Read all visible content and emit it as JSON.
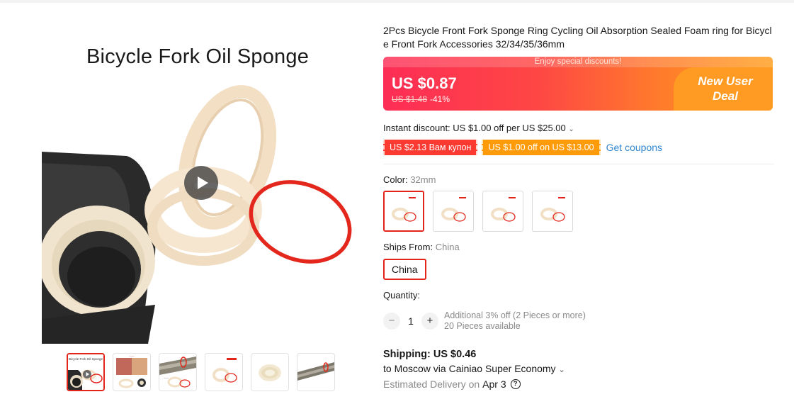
{
  "colors": {
    "accent": "#e2241b",
    "link": "#2f86d1",
    "coupon_red": "#fb3b32",
    "coupon_orange": "#ff9b08"
  },
  "gallery": {
    "hero_title": "Bicycle Fork Oil Sponge",
    "play_icon": "play-icon",
    "thumbnails": [
      {
        "name": "thumb-1",
        "active": true
      },
      {
        "name": "thumb-2",
        "active": false
      },
      {
        "name": "thumb-3",
        "active": false
      },
      {
        "name": "thumb-4",
        "active": false
      },
      {
        "name": "thumb-5",
        "active": false
      },
      {
        "name": "thumb-6",
        "active": false
      }
    ]
  },
  "product": {
    "title": "2Pcs Bicycle Front Fork Sponge Ring Cycling Oil Absorption Sealed Foam ring for Bicycle Front Fork Accessories 32/34/35/36mm"
  },
  "price": {
    "banner_caption": "Enjoy special discounts!",
    "current": "US $0.87",
    "original": "US $1.48",
    "discount": "-41%",
    "deal_line1": "New User",
    "deal_line2": "Deal"
  },
  "discounts": {
    "instant": "Instant discount: US $1.00 off per US $25.00",
    "coupon_1": "US $2.13 Вам купон",
    "coupon_2": "US $1.00 off on US $13.00",
    "get_coupons": "Get coupons"
  },
  "color": {
    "label": "Color:",
    "selected": "32mm",
    "options_count": 4
  },
  "ships_from": {
    "label": "Ships From:",
    "selected": "China",
    "option": "China"
  },
  "quantity": {
    "label": "Quantity:",
    "minus": "−",
    "value": "1",
    "plus": "+",
    "note_1": "Additional 3% off (2 Pieces or more)",
    "note_2": "20 Pieces available"
  },
  "shipping": {
    "title": "Shipping: US $0.46",
    "route": "to Moscow via Cainiao Super Economy",
    "eta_label": "Estimated Delivery on",
    "eta_date": "Apr 3",
    "help_icon": "?"
  }
}
